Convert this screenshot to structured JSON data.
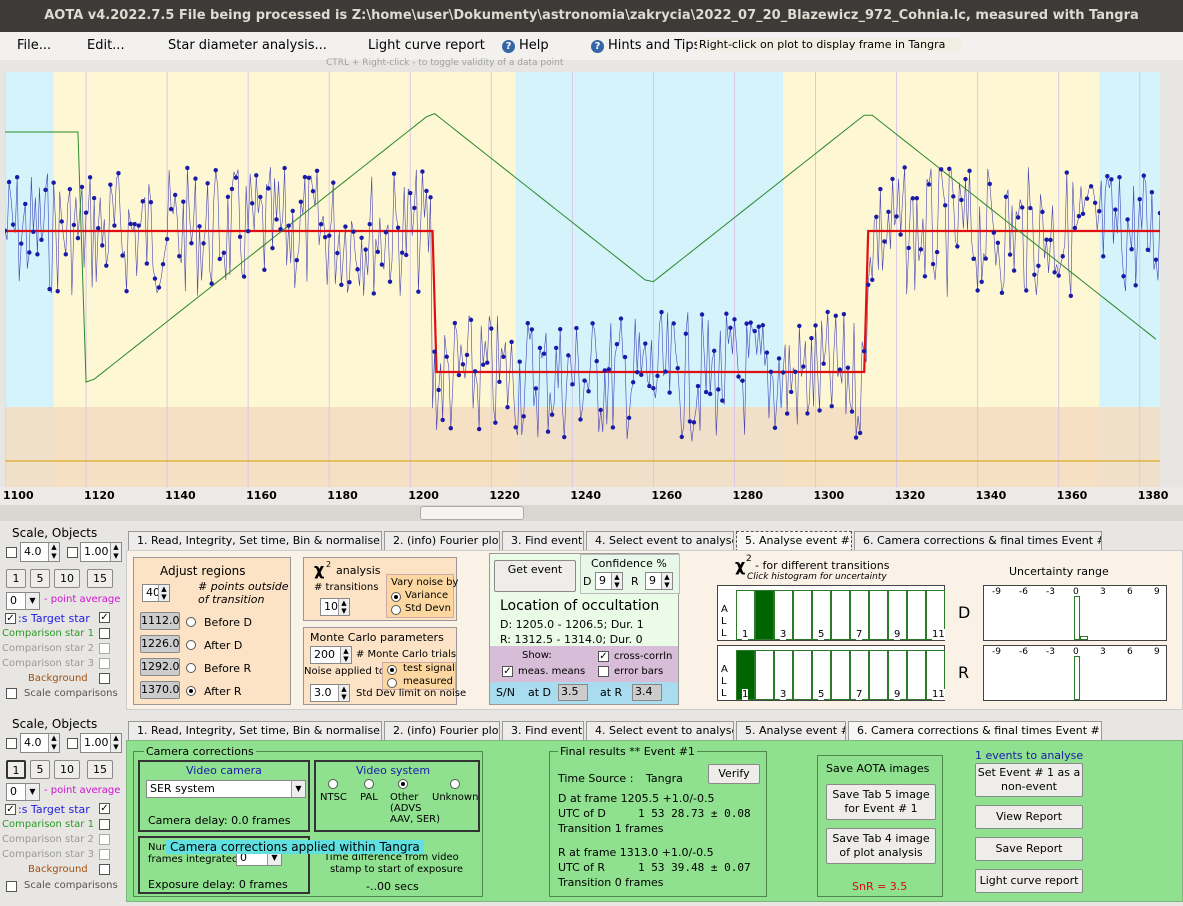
{
  "window": {
    "title": "AOTA v4.2022.7.5    File being processed is Z:\\home\\user\\Dokumenty\\astronomia\\zakrycia\\2022_07_20_Blazewicz_972_Cohnia.lc, measured with Tangra"
  },
  "menu": {
    "file": "File...",
    "edit": "Edit...",
    "star_diameter": "Star diameter analysis...",
    "light_curve_report": "Light curve report",
    "help": "Help",
    "hints": "Hints and Tips"
  },
  "hints": {
    "right_click": "Right-click on plot to display frame in Tangra",
    "ctrl_right_click": "CTRL + Right-click   -   to toggle validity of a data point"
  },
  "colors": {
    "band_outside": "#fef7d4",
    "band_transition": "#d4f3fb",
    "band_bottom": "#f5dcc0",
    "data_line": "#1a1aa8",
    "model_line": "#e01010",
    "chi_line": "#2a8a2a",
    "hist_fill": "#006400",
    "tab6_bg": "#8fe08f",
    "snr_text": "#d01010"
  },
  "plot": {
    "x_ticks": [
      "1100",
      "1120",
      "1140",
      "1160",
      "1180",
      "1200",
      "1220",
      "1240",
      "1260",
      "1280",
      "1300",
      "1320",
      "1340",
      "1360",
      "1380"
    ],
    "x_min": 1100,
    "x_max": 1385
  },
  "left_panel": {
    "title": "Scale, Objects",
    "scale_left": "4.0",
    "scale_right": "1.00",
    "buttons": [
      "1",
      "5",
      "10",
      "15"
    ],
    "point_avg_value": "0",
    "point_avg_label": "- point average",
    "target_star": ":s  Target star",
    "comparison1": "Comparison star 1",
    "comparison2": "Comparison star 2",
    "comparison3": "Comparison star 3",
    "background": "Background",
    "scale_comparisons": "Scale comparisons"
  },
  "tabs": [
    "1.  Read, Integrity, Set time, Bin & normalise",
    "2. (info)  Fourier plot",
    "3. Find events",
    "4. Select event to analyse",
    "5. Analyse event #1",
    "6. Camera corrections & final times Event #1"
  ],
  "tab5": {
    "adjust": {
      "title": "Adjust regions",
      "points_value": "40",
      "points_label1": "# points outside",
      "points_label2": "of transition",
      "rows": [
        {
          "value": "1112.0",
          "label": "Before D"
        },
        {
          "value": "1226.0",
          "label": "After D"
        },
        {
          "value": "1292.0",
          "label": "Before R"
        },
        {
          "value": "1370.0",
          "label": "After R"
        }
      ]
    },
    "chi": {
      "title": "analysis",
      "transitions_label": "# transitions",
      "transitions_value": "10",
      "vary_label1": "Vary noise by",
      "variance": "Variance",
      "std_devn": "Std Devn"
    },
    "monte": {
      "title": "Monte Carlo parameters",
      "trials_value": "200",
      "trials_label": "# Monte Carlo trials",
      "noise_applied": "Noise applied to",
      "test_signal": "test signal",
      "measured": "measured",
      "stddev_value": "3.0",
      "stddev_label": "Std Dev limit on noise"
    },
    "event": {
      "get_event": "Get event",
      "confidence": "Confidence %",
      "d_label": "D",
      "d_value": "9",
      "r_label": "R",
      "r_value": "9",
      "location_title": "Location of occultation",
      "d_line": "D: 1205.0 - 1206.5; Dur. 1",
      "r_line": "R: 1312.5 - 1314.0; Dur. 0",
      "show": "Show:",
      "cross_corr": "cross-corrln",
      "meas_means": "meas. means",
      "error_bars": "error bars",
      "sn": "S/N",
      "at_d": "at D",
      "at_d_value": "3.5",
      "at_r": "at R",
      "at_r_value": "3.4"
    },
    "chi_hist": {
      "title": " - for different transitions",
      "subtitle": "Click histogram for uncertainty",
      "all": [
        "A",
        "L",
        "L"
      ],
      "ticks": [
        "1",
        "3",
        "5",
        "7",
        "9",
        "11"
      ],
      "d_label": "D",
      "r_label": "R",
      "d_selected": 2,
      "r_selected": 1
    },
    "uncertainty": {
      "title": "Uncertainty range",
      "ticks": [
        "-9",
        "-6",
        "-3",
        "0",
        "3",
        "6",
        "9"
      ]
    }
  },
  "tab6": {
    "camera_corr_title": "Camera corrections",
    "video_camera_title": "Video camera",
    "camera_select": "SER system",
    "camera_delay": "Camera delay: 0.0 frames",
    "video_system_title": "Video system",
    "ntsc": "NTSC",
    "pal": "PAL",
    "other": "Other",
    "other_detail1": "(ADVS",
    "other_detail2": "AAV, SER)",
    "unknown": "Unknown",
    "num_frames1": "Num",
    "num_frames2": "frames integrated",
    "frames_value": "0",
    "overlay": "Camera corrections applied within Tangra",
    "exposure_delay": "Exposure delay:  0 frames",
    "timediff1": "Time difference from video",
    "timediff2": "stamp to start of exposure",
    "timediff_value": "-..00 secs",
    "final_title": "Final results  **  Event #1",
    "time_source_label": "Time Source :",
    "time_source": "Tangra",
    "verify": "Verify",
    "d_frame": "D    at frame 1205.5  +1.0/-0.5",
    "utc_d_label": "UTC of D",
    "utc_d": "1  53  28.73   ± 0.08",
    "transition_d": "Transition  1 frames",
    "r_frame": "R    at frame 1313.0  +1.0/-0.5",
    "utc_r_label": "UTC of R",
    "utc_r": "1  53  39.48   ± 0.07",
    "transition_r": "Transition  0 frames",
    "save_title": "Save AOTA images",
    "save_tab5": "Save Tab 5 image for Event # 1",
    "save_tab4": "Save Tab 4 image of plot analysis",
    "snr": "SnR = 3.5",
    "events_to_analyse": "1  events to analyse",
    "set_event": "Set Event # 1 as a non-event",
    "view_report": "View Report",
    "save_report": "Save Report",
    "lc_report": "Light curve report"
  }
}
